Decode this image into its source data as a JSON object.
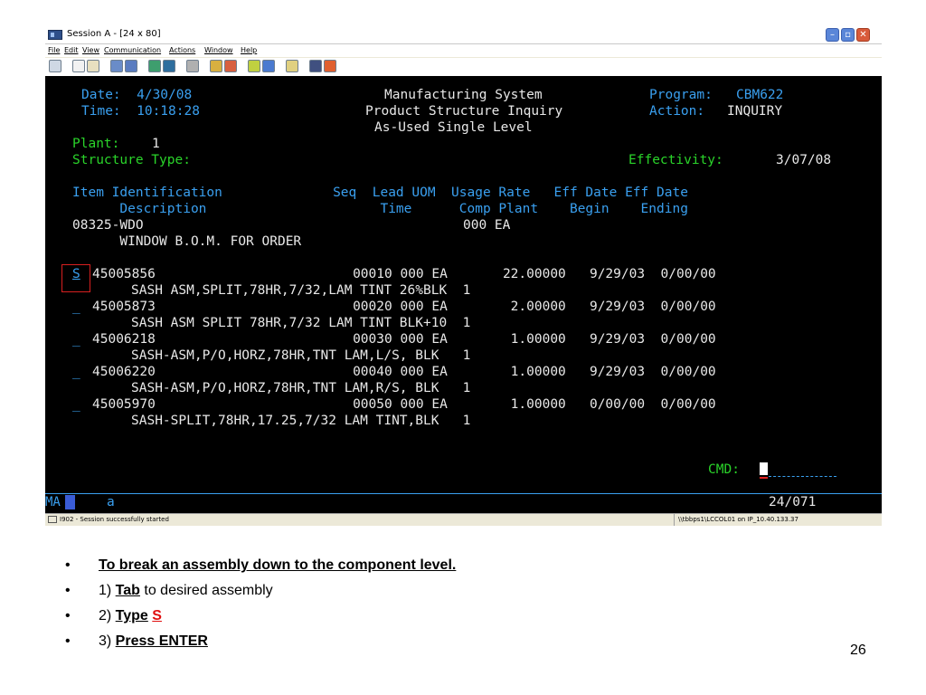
{
  "window": {
    "title": "Session A - [24 x 80]",
    "menu": [
      "File",
      "Edit",
      "View",
      "Communication",
      "Actions",
      "Window",
      "Help"
    ]
  },
  "terminal": {
    "header": {
      "date": "Date:  4/30/08",
      "time": "Time:  10:18:28",
      "system": "Manufacturing System",
      "inquiry": "Product Structure Inquiry",
      "level": "As-Used Single Level",
      "program_label": "Program:",
      "program_value": "CBM622",
      "action_label": "Action:",
      "action_value": "INQUIRY",
      "plant_label": "Plant:",
      "plant_value": "1",
      "structure_type_label": "Structure Type:",
      "effectivity_label": "Effectivity:",
      "effectivity_value": "3/07/08"
    },
    "columns": {
      "line1": "Item Identification              Seq  Lead UOM  Usage Rate   Eff Date Eff Date",
      "line2": "      Description                      Time      Comp Plant    Begin    Ending"
    },
    "parent": {
      "item": "08325-WDO",
      "value": "000 EA",
      "description": "      WINDOW B.O.M. FOR ORDER"
    },
    "rows": [
      {
        "sel": "S",
        "line": "45005856                         00010 000 EA       22.00000   9/29/03  0/00/00",
        "desc": "SASH ASM,SPLIT,78HR,7/32,LAM TINT 26%BLK  1"
      },
      {
        "sel": "_",
        "line": "45005873                         00020 000 EA        2.00000   9/29/03  0/00/00",
        "desc": "SASH ASM SPLIT 78HR,7/32 LAM TINT BLK+10  1"
      },
      {
        "sel": "_",
        "line": "45006218                         00030 000 EA        1.00000   9/29/03  0/00/00",
        "desc": "SASH-ASM,P/O,HORZ,78HR,TNT LAM,L/S, BLK   1"
      },
      {
        "sel": "_",
        "line": "45006220                         00040 000 EA        1.00000   9/29/03  0/00/00",
        "desc": "SASH-ASM,P/O,HORZ,78HR,TNT LAM,R/S, BLK   1"
      },
      {
        "sel": "_",
        "line": "45005970                         00050 000 EA        1.00000   0/00/00  0/00/00",
        "desc": "SASH-SPLIT,78HR,17.25,7/32 LAM TINT,BLK   1"
      }
    ],
    "cmd_label": "CMD:",
    "oia": {
      "ma": "MA",
      "a": "a",
      "position": "24/071"
    }
  },
  "statusbar": {
    "message": "I902 - Session successfully started",
    "host": "\\\\tbbps1\\LCCOL01 on IP_10.40.133.37"
  },
  "slide": {
    "bullets": {
      "b1": "To break an assembly down to the component level.",
      "b2_prefix": "1) ",
      "b2_key": "Tab",
      "b2_suffix": " to desired assembly",
      "b3_prefix": "2) ",
      "b3_key": "Type",
      "b3_red": "S",
      "b4_prefix": "3) ",
      "b4_key": "Press ENTER"
    },
    "page_number": "26"
  }
}
